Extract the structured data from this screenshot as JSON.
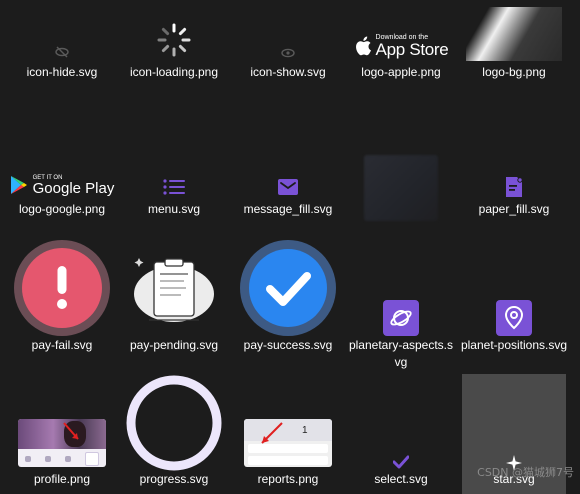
{
  "colors": {
    "background": "#1c1c1c",
    "purple": "#7a52d6",
    "fail_red": "#e5576e",
    "success_blue": "#2a86f0",
    "selected_tile": "#4a4a4a",
    "progress_ring": "#ece6fb"
  },
  "files": [
    {
      "name": "icon-hide.svg",
      "icon": "eye-hide-icon"
    },
    {
      "name": "icon-loading.png",
      "icon": "loading-spinner-icon"
    },
    {
      "name": "icon-show.svg",
      "icon": "eye-show-icon"
    },
    {
      "name": "logo-apple.png",
      "icon": "app-store-badge",
      "badge_small": "Download on the",
      "badge_large": "App Store"
    },
    {
      "name": "logo-bg.png",
      "icon": "gradient-background-image"
    },
    {
      "name": "logo-google.png",
      "icon": "google-play-badge",
      "badge_small": "GET IT ON",
      "badge_large": "Google Play"
    },
    {
      "name": "menu.svg",
      "icon": "menu-list-icon"
    },
    {
      "name": "message_fill.svg",
      "icon": "envelope-icon"
    },
    {
      "name": "",
      "icon": "blurred-image"
    },
    {
      "name": "paper_fill.svg",
      "icon": "document-icon"
    },
    {
      "name": "pay-fail.svg",
      "icon": "exclamation-circle-icon"
    },
    {
      "name": "pay-pending.svg",
      "icon": "clipboard-icon"
    },
    {
      "name": "pay-success.svg",
      "icon": "checkmark-circle-icon"
    },
    {
      "name": "planetary-aspects.svg",
      "icon": "planet-icon"
    },
    {
      "name": "planet-positions.svg",
      "icon": "location-pin-icon"
    },
    {
      "name": "profile.png",
      "icon": "profile-screenshot-image"
    },
    {
      "name": "progress.svg",
      "icon": "progress-ring-icon"
    },
    {
      "name": "reports.png",
      "icon": "reports-screenshot-image",
      "report_value": "1"
    },
    {
      "name": "select.svg",
      "icon": "checkmark-icon"
    },
    {
      "name": "star.svg",
      "icon": "sparkle-star-icon"
    }
  ],
  "watermark": "CSDN @猫城狮7号"
}
